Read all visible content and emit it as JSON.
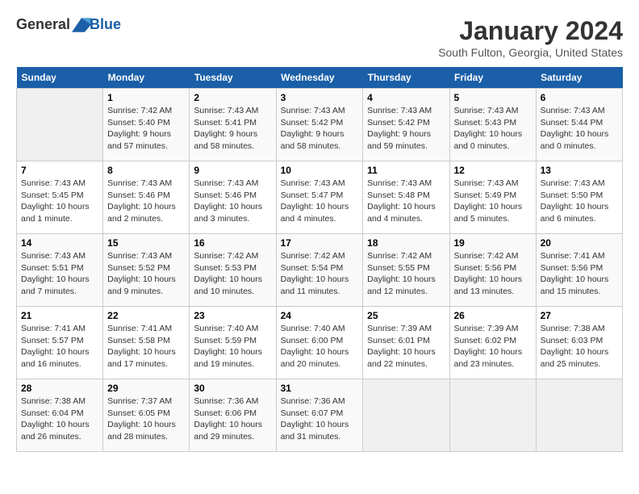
{
  "header": {
    "logo_text_general": "General",
    "logo_text_blue": "Blue",
    "title": "January 2024",
    "subtitle": "South Fulton, Georgia, United States"
  },
  "calendar": {
    "days_of_week": [
      "Sunday",
      "Monday",
      "Tuesday",
      "Wednesday",
      "Thursday",
      "Friday",
      "Saturday"
    ],
    "weeks": [
      [
        {
          "day": "",
          "info": ""
        },
        {
          "day": "1",
          "info": "Sunrise: 7:42 AM\nSunset: 5:40 PM\nDaylight: 9 hours\nand 57 minutes."
        },
        {
          "day": "2",
          "info": "Sunrise: 7:43 AM\nSunset: 5:41 PM\nDaylight: 9 hours\nand 58 minutes."
        },
        {
          "day": "3",
          "info": "Sunrise: 7:43 AM\nSunset: 5:42 PM\nDaylight: 9 hours\nand 58 minutes."
        },
        {
          "day": "4",
          "info": "Sunrise: 7:43 AM\nSunset: 5:42 PM\nDaylight: 9 hours\nand 59 minutes."
        },
        {
          "day": "5",
          "info": "Sunrise: 7:43 AM\nSunset: 5:43 PM\nDaylight: 10 hours\nand 0 minutes."
        },
        {
          "day": "6",
          "info": "Sunrise: 7:43 AM\nSunset: 5:44 PM\nDaylight: 10 hours\nand 0 minutes."
        }
      ],
      [
        {
          "day": "7",
          "info": "Sunrise: 7:43 AM\nSunset: 5:45 PM\nDaylight: 10 hours\nand 1 minute."
        },
        {
          "day": "8",
          "info": "Sunrise: 7:43 AM\nSunset: 5:46 PM\nDaylight: 10 hours\nand 2 minutes."
        },
        {
          "day": "9",
          "info": "Sunrise: 7:43 AM\nSunset: 5:46 PM\nDaylight: 10 hours\nand 3 minutes."
        },
        {
          "day": "10",
          "info": "Sunrise: 7:43 AM\nSunset: 5:47 PM\nDaylight: 10 hours\nand 4 minutes."
        },
        {
          "day": "11",
          "info": "Sunrise: 7:43 AM\nSunset: 5:48 PM\nDaylight: 10 hours\nand 4 minutes."
        },
        {
          "day": "12",
          "info": "Sunrise: 7:43 AM\nSunset: 5:49 PM\nDaylight: 10 hours\nand 5 minutes."
        },
        {
          "day": "13",
          "info": "Sunrise: 7:43 AM\nSunset: 5:50 PM\nDaylight: 10 hours\nand 6 minutes."
        }
      ],
      [
        {
          "day": "14",
          "info": "Sunrise: 7:43 AM\nSunset: 5:51 PM\nDaylight: 10 hours\nand 7 minutes."
        },
        {
          "day": "15",
          "info": "Sunrise: 7:43 AM\nSunset: 5:52 PM\nDaylight: 10 hours\nand 9 minutes."
        },
        {
          "day": "16",
          "info": "Sunrise: 7:42 AM\nSunset: 5:53 PM\nDaylight: 10 hours\nand 10 minutes."
        },
        {
          "day": "17",
          "info": "Sunrise: 7:42 AM\nSunset: 5:54 PM\nDaylight: 10 hours\nand 11 minutes."
        },
        {
          "day": "18",
          "info": "Sunrise: 7:42 AM\nSunset: 5:55 PM\nDaylight: 10 hours\nand 12 minutes."
        },
        {
          "day": "19",
          "info": "Sunrise: 7:42 AM\nSunset: 5:56 PM\nDaylight: 10 hours\nand 13 minutes."
        },
        {
          "day": "20",
          "info": "Sunrise: 7:41 AM\nSunset: 5:56 PM\nDaylight: 10 hours\nand 15 minutes."
        }
      ],
      [
        {
          "day": "21",
          "info": "Sunrise: 7:41 AM\nSunset: 5:57 PM\nDaylight: 10 hours\nand 16 minutes."
        },
        {
          "day": "22",
          "info": "Sunrise: 7:41 AM\nSunset: 5:58 PM\nDaylight: 10 hours\nand 17 minutes."
        },
        {
          "day": "23",
          "info": "Sunrise: 7:40 AM\nSunset: 5:59 PM\nDaylight: 10 hours\nand 19 minutes."
        },
        {
          "day": "24",
          "info": "Sunrise: 7:40 AM\nSunset: 6:00 PM\nDaylight: 10 hours\nand 20 minutes."
        },
        {
          "day": "25",
          "info": "Sunrise: 7:39 AM\nSunset: 6:01 PM\nDaylight: 10 hours\nand 22 minutes."
        },
        {
          "day": "26",
          "info": "Sunrise: 7:39 AM\nSunset: 6:02 PM\nDaylight: 10 hours\nand 23 minutes."
        },
        {
          "day": "27",
          "info": "Sunrise: 7:38 AM\nSunset: 6:03 PM\nDaylight: 10 hours\nand 25 minutes."
        }
      ],
      [
        {
          "day": "28",
          "info": "Sunrise: 7:38 AM\nSunset: 6:04 PM\nDaylight: 10 hours\nand 26 minutes."
        },
        {
          "day": "29",
          "info": "Sunrise: 7:37 AM\nSunset: 6:05 PM\nDaylight: 10 hours\nand 28 minutes."
        },
        {
          "day": "30",
          "info": "Sunrise: 7:36 AM\nSunset: 6:06 PM\nDaylight: 10 hours\nand 29 minutes."
        },
        {
          "day": "31",
          "info": "Sunrise: 7:36 AM\nSunset: 6:07 PM\nDaylight: 10 hours\nand 31 minutes."
        },
        {
          "day": "",
          "info": ""
        },
        {
          "day": "",
          "info": ""
        },
        {
          "day": "",
          "info": ""
        }
      ]
    ]
  }
}
